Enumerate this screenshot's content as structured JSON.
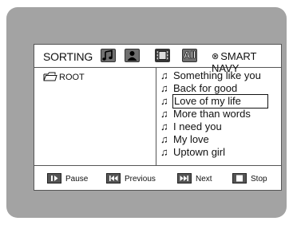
{
  "header": {
    "sorting_label": "SORTING",
    "sort_options": [
      {
        "icon": "music-note-icon",
        "label": ""
      },
      {
        "icon": "person-icon",
        "label": ""
      },
      {
        "icon": "film-icon",
        "label": ""
      },
      {
        "icon": "all-icon",
        "label": "All"
      }
    ],
    "smart_navy_icon": "⊗",
    "smart_navy_label": "SMART NAVY"
  },
  "folder": {
    "name": "ROOT",
    "icon": "folder-icon"
  },
  "tracks": [
    {
      "title": "Something like you"
    },
    {
      "title": "Back for good"
    },
    {
      "title": "Love of my life",
      "selected": true
    },
    {
      "title": "More than words"
    },
    {
      "title": "I need you"
    },
    {
      "title": "My love"
    },
    {
      "title": "Uptown girl"
    }
  ],
  "track_icon": "♫",
  "controls": [
    {
      "label": "Pause",
      "icon": "pause-icon"
    },
    {
      "label": "Previous",
      "icon": "previous-icon"
    },
    {
      "label": "Next",
      "icon": "next-icon"
    },
    {
      "label": "Stop",
      "icon": "stop-icon"
    }
  ]
}
